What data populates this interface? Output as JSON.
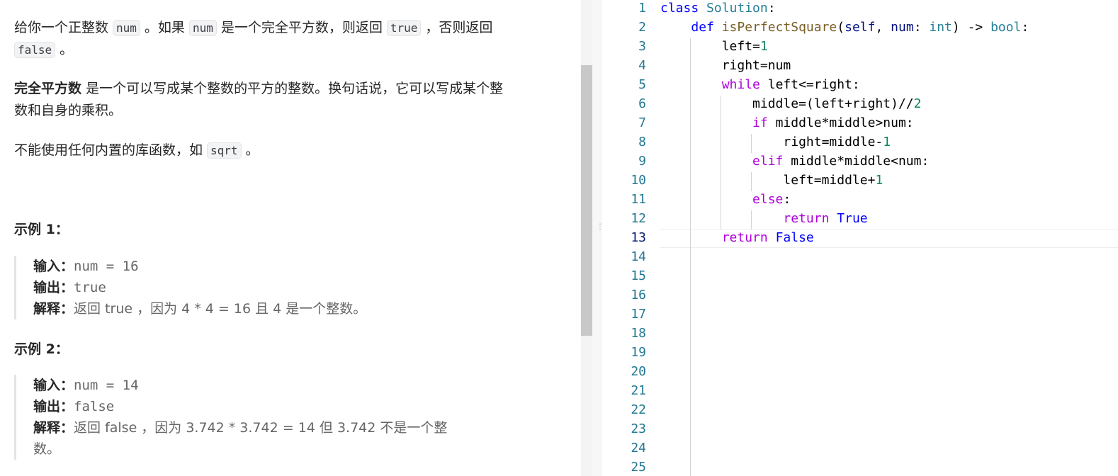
{
  "problem": {
    "p1": {
      "t1": "给你一个正整数",
      "c1": "num",
      "t2": "。如果",
      "c2": "num",
      "t3": "是一个完全平方数，则返回",
      "c3": "true",
      "t4": "，否则返回",
      "c4": "false",
      "t5": "。"
    },
    "p2": {
      "bold": "完全平方数",
      "line1": "是一个可以写成某个整数的平方的整数。换句话说，它可以写成某个整",
      "line2": "数和自身的乘积。"
    },
    "p3": {
      "text": "不能使用任何内置的库函数，如",
      "code": "sqrt",
      "end": "。"
    },
    "example1": {
      "title": "示例 1：",
      "input_key": "输入：",
      "input_val": "num = 16",
      "output_key": "输出：",
      "output_val": "true",
      "explain_key": "解释：",
      "explain_val": "返回 true ，因为 4 * 4 = 16 且 4 是一个整数。"
    },
    "example2": {
      "title": "示例 2：",
      "input_key": "输入：",
      "input_val": "num = 14",
      "output_key": "输出：",
      "output_val": "false",
      "explain_key": "解释：",
      "explain_val_line1": "返回 false ，因为 3.742 * 3.742 = 14 但 3.742 不是一个整",
      "explain_val_line2": "数。"
    }
  },
  "editor": {
    "active_line": 13,
    "line_numbers": [
      "1",
      "2",
      "3",
      "4",
      "5",
      "6",
      "7",
      "8",
      "9",
      "10",
      "11",
      "12",
      "13",
      "14",
      "15",
      "16",
      "17",
      "18",
      "19",
      "20",
      "21",
      "22",
      "23",
      "24",
      "25"
    ],
    "code_lines": [
      [
        {
          "t": "class ",
          "k": "kw"
        },
        {
          "t": "Solution",
          "k": "cls"
        },
        {
          "t": ":",
          "k": "plain"
        }
      ],
      [
        {
          "t": "    ",
          "k": "plain"
        },
        {
          "t": "def ",
          "k": "kw"
        },
        {
          "t": "isPerfectSquare",
          "k": "fn"
        },
        {
          "t": "(",
          "k": "plain"
        },
        {
          "t": "self",
          "k": "param"
        },
        {
          "t": ", ",
          "k": "plain"
        },
        {
          "t": "num",
          "k": "param"
        },
        {
          "t": ": ",
          "k": "plain"
        },
        {
          "t": "int",
          "k": "cls"
        },
        {
          "t": ") -> ",
          "k": "plain"
        },
        {
          "t": "bool",
          "k": "cls"
        },
        {
          "t": ":",
          "k": "plain"
        }
      ],
      [
        {
          "t": "        left=",
          "k": "plain"
        },
        {
          "t": "1",
          "k": "num"
        }
      ],
      [
        {
          "t": "        right=num",
          "k": "plain"
        }
      ],
      [
        {
          "t": "        ",
          "k": "plain"
        },
        {
          "t": "while",
          "k": "ctrl"
        },
        {
          "t": " left<=right:",
          "k": "plain"
        }
      ],
      [
        {
          "t": "            middle=(left+right)//",
          "k": "plain"
        },
        {
          "t": "2",
          "k": "num"
        }
      ],
      [
        {
          "t": "            ",
          "k": "plain"
        },
        {
          "t": "if",
          "k": "ctrl"
        },
        {
          "t": " middle*middle>num:",
          "k": "plain"
        }
      ],
      [
        {
          "t": "                right=middle-",
          "k": "plain"
        },
        {
          "t": "1",
          "k": "num"
        }
      ],
      [
        {
          "t": "            ",
          "k": "plain"
        },
        {
          "t": "elif",
          "k": "ctrl"
        },
        {
          "t": " middle*middle<num:",
          "k": "plain"
        }
      ],
      [
        {
          "t": "                left=middle+",
          "k": "plain"
        },
        {
          "t": "1",
          "k": "num"
        }
      ],
      [
        {
          "t": "            ",
          "k": "plain"
        },
        {
          "t": "else",
          "k": "ctrl"
        },
        {
          "t": ":",
          "k": "plain"
        }
      ],
      [
        {
          "t": "                ",
          "k": "plain"
        },
        {
          "t": "return",
          "k": "ctrl"
        },
        {
          "t": " ",
          "k": "plain"
        },
        {
          "t": "True",
          "k": "kw"
        }
      ],
      [
        {
          "t": "        ",
          "k": "plain"
        },
        {
          "t": "return",
          "k": "ctrl"
        },
        {
          "t": " ",
          "k": "plain"
        },
        {
          "t": "False",
          "k": "kw"
        }
      ]
    ]
  }
}
